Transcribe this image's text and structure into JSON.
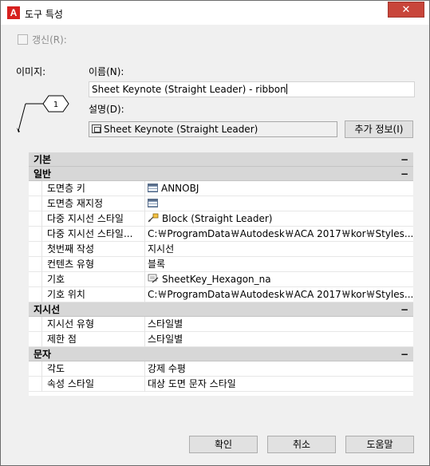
{
  "window": {
    "title": "도구 특성",
    "close_glyph": "✕"
  },
  "refresh": {
    "label": "갱신(R):"
  },
  "image_label": "이미지:",
  "name": {
    "label": "이름(N):",
    "value": "Sheet Keynote (Straight Leader) - ribbon"
  },
  "description": {
    "label": "설명(D):",
    "value": "Sheet Keynote (Straight Leader)"
  },
  "more_info_button": "추가 정보(I)",
  "preview": {
    "tag_number": "1"
  },
  "properties": {
    "basic": {
      "title": "기본",
      "toggle": "−"
    },
    "general": {
      "title": "일반",
      "toggle": "−",
      "rows": [
        {
          "name": "도면층 키",
          "value": "ANNOBJ",
          "icon": "table-icon"
        },
        {
          "name": "도면층 재지정",
          "value": "",
          "icon": "table-icon"
        },
        {
          "name": "다중 지시선 스타일",
          "value": "Block (Straight Leader)",
          "icon": "leader-icon"
        },
        {
          "name": "다중 지시선 스타일...",
          "value": "C:￦ProgramData￦Autodesk￦ACA  2017￦kor￦Styles...",
          "icon": ""
        },
        {
          "name": "첫번째 작성",
          "value": "지시선",
          "icon": ""
        },
        {
          "name": "컨텐츠 유형",
          "value": "블록",
          "icon": ""
        },
        {
          "name": "기호",
          "value": "SheetKey_Hexagon_na",
          "icon": "symbol-icon"
        },
        {
          "name": "기호 위치",
          "value": "C:￦ProgramData￦Autodesk￦ACA  2017￦kor￦Styles...",
          "icon": ""
        }
      ]
    },
    "leader": {
      "title": "지시선",
      "toggle": "−",
      "rows": [
        {
          "name": "지시선 유형",
          "value": "스타일별"
        },
        {
          "name": "제한 점",
          "value": "스타일별"
        }
      ]
    },
    "text": {
      "title": "문자",
      "toggle": "−",
      "rows": [
        {
          "name": "각도",
          "value": "강제 수평"
        },
        {
          "name": "속성 스타일",
          "value": "대상 도면 문자 스타일"
        }
      ]
    }
  },
  "buttons": {
    "ok": "확인",
    "cancel": "취소",
    "help": "도움말"
  }
}
